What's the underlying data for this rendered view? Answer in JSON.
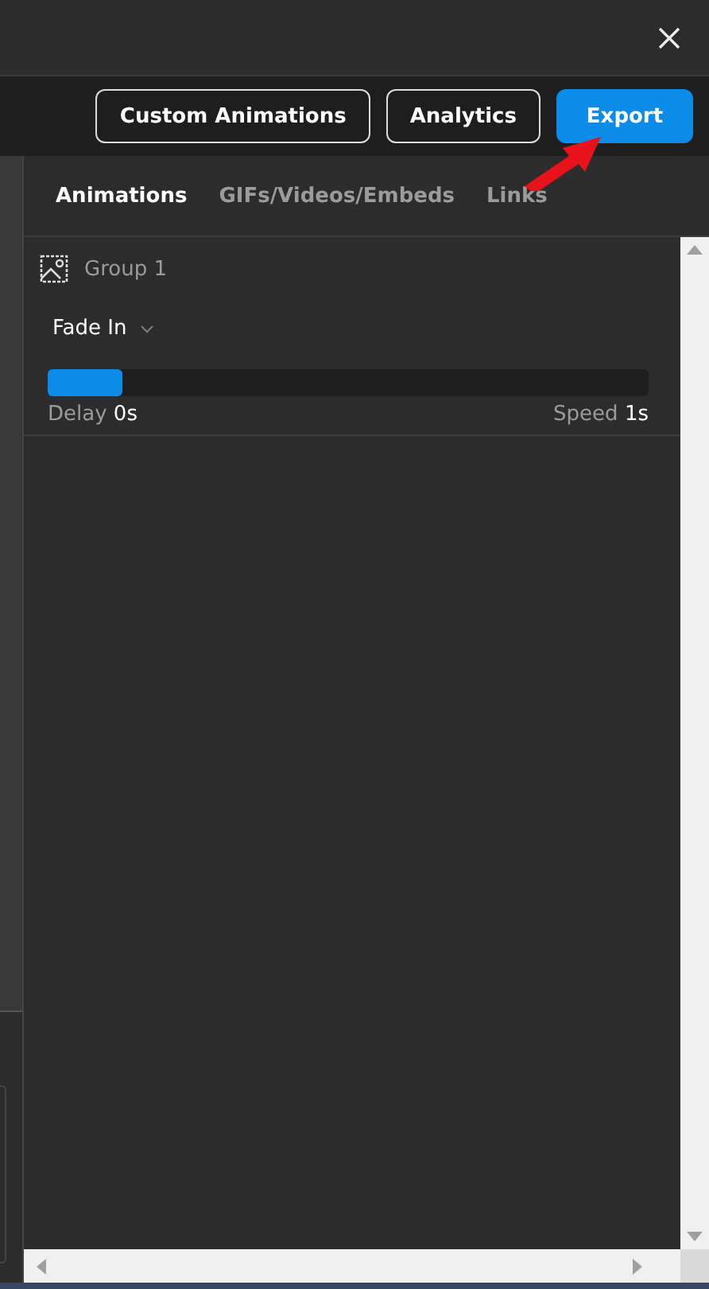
{
  "toolbar": {
    "buttons": [
      {
        "label": "Custom Animations",
        "kind": "outline"
      },
      {
        "label": "Analytics",
        "kind": "outline"
      },
      {
        "label": "Export",
        "kind": "primary"
      }
    ]
  },
  "tabs": [
    {
      "label": "Animations",
      "selected": true
    },
    {
      "label": "GIFs/Videos/Embeds",
      "selected": false
    },
    {
      "label": "Links",
      "selected": false
    }
  ],
  "group": {
    "title": "Group 1",
    "animation": "Fade In",
    "level": 0.125,
    "delay_label": "Delay",
    "delay": "0s",
    "speed_label": "Speed",
    "speed": "1s"
  }
}
